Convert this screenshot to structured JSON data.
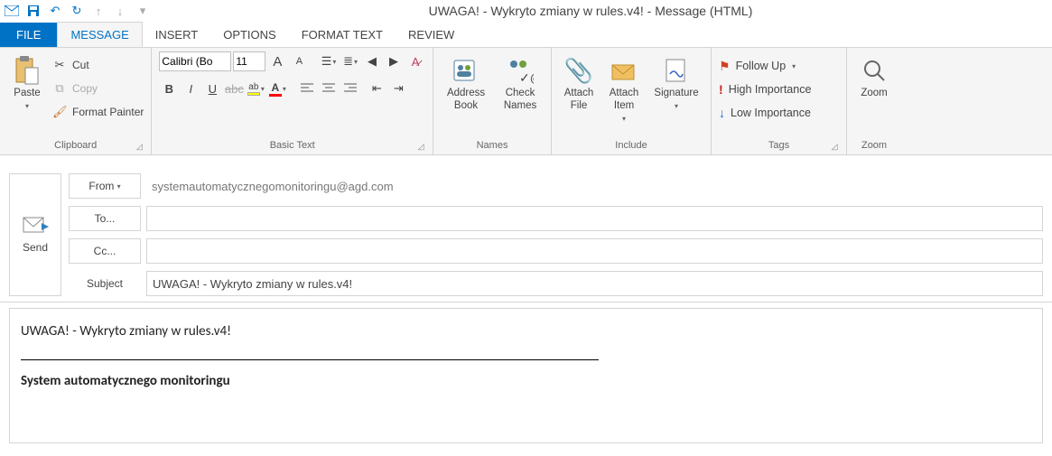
{
  "window_title": "UWAGA! - Wykryto zmiany w rules.v4! - Message (HTML)",
  "tabs": {
    "file": "FILE",
    "message": "MESSAGE",
    "insert": "INSERT",
    "options": "OPTIONS",
    "format": "FORMAT TEXT",
    "review": "REVIEW"
  },
  "ribbon": {
    "clipboard": {
      "label": "Clipboard",
      "paste": "Paste",
      "cut": "Cut",
      "copy": "Copy",
      "painter": "Format Painter"
    },
    "basictext": {
      "label": "Basic Text",
      "font_name": "Calibri (Bo",
      "font_size": "11"
    },
    "names": {
      "label": "Names",
      "address_book": "Address\nBook",
      "check_names": "Check\nNames"
    },
    "include": {
      "label": "Include",
      "attach_file": "Attach\nFile",
      "attach_item": "Attach\nItem",
      "signature": "Signature"
    },
    "tags": {
      "label": "Tags",
      "follow_up": "Follow Up",
      "high": "High Importance",
      "low": "Low Importance"
    },
    "zoom": {
      "label": "Zoom",
      "zoom": "Zoom"
    }
  },
  "compose": {
    "send": "Send",
    "from_btn": "From",
    "from_value": "systemautomatycznegomonitoringu@agd.com",
    "to_btn": "To...",
    "to_value": "",
    "cc_btn": "Cc...",
    "cc_value": "",
    "subject_lbl": "Subject",
    "subject_value": "UWAGA! - Wykryto zmiany w rules.v4!"
  },
  "body": {
    "line1": "UWAGA! - Wykryto zmiany w rules.v4!",
    "signature": "System automatycznego monitoringu"
  }
}
